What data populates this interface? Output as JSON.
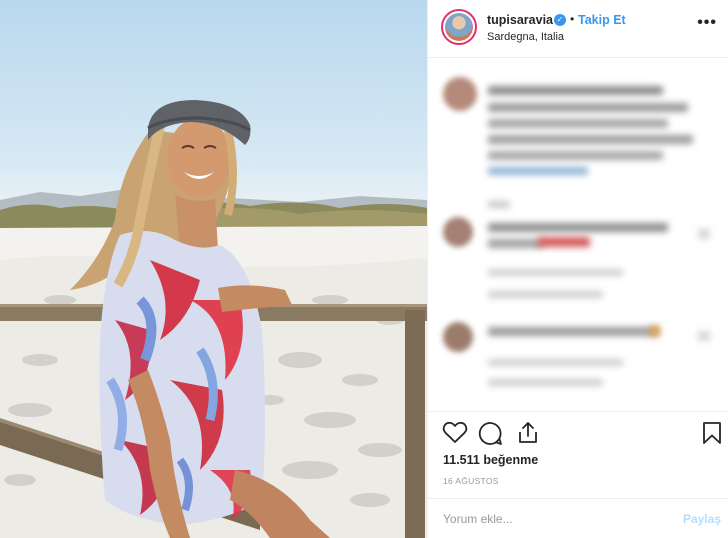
{
  "post": {
    "username": "tupisaravia",
    "verified_mark": "✓",
    "separator": "•",
    "follow_label": "Takip Et",
    "location": "Sardegna, Italia",
    "more_label": "•••",
    "likes": "11.511 beğenme",
    "date": "16 AĞUSTOS",
    "comment_placeholder": "Yorum ekle...",
    "share_label": "Paylaş"
  },
  "icons": {
    "like": "heart-icon",
    "comment": "comment-icon",
    "share": "share-icon",
    "save": "bookmark-icon"
  },
  "colors": {
    "accent": "#3897f0",
    "text": "#262626",
    "muted": "#999999",
    "disabled_link": "#b2dffc"
  }
}
